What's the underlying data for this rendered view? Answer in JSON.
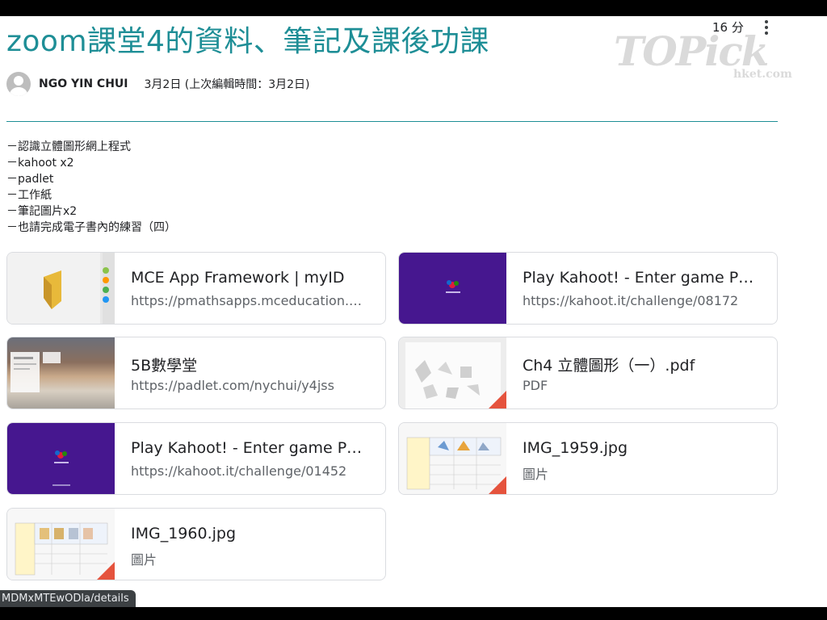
{
  "post": {
    "title": "zoom課堂4的資料、筆記及課後功課",
    "author": "NGO YIN CHUI",
    "date": "3月2日 (上次編輯時間：3月2日)",
    "comment_count": "16 分",
    "watermark": "TOPick",
    "watermark_sub": "hket.com"
  },
  "description": [
    "－認識立體圖形網上程式",
    "－kahoot x2",
    "－padlet",
    "－工作紙",
    "－筆記圖片x2",
    "－也請完成電子書內的練習（四）"
  ],
  "attachments": [
    {
      "title": "MCE App Framework | myID",
      "subtitle": "https://pmathsapps.mceducation.com",
      "thumb": "app"
    },
    {
      "title": "Play Kahoot! - Enter game PIN here!",
      "subtitle": "https://kahoot.it/challenge/08172",
      "thumb": "kahoot"
    },
    {
      "title": "5B數學堂",
      "subtitle": "https://padlet.com/nychui/y4jss",
      "thumb": "padlet"
    },
    {
      "title": "Ch4 立體圖形（一）.pdf",
      "subtitle": "PDF",
      "thumb": "pdf"
    },
    {
      "title": "Play Kahoot! - Enter game PIN here!",
      "subtitle": "https://kahoot.it/challenge/01452",
      "thumb": "kahoot"
    },
    {
      "title": "IMG_1959.jpg",
      "subtitle": "圖片",
      "thumb": "image"
    },
    {
      "title": "IMG_1960.jpg",
      "subtitle": "圖片",
      "thumb": "image"
    }
  ],
  "status_bar": "MDMxMTEwODla/details",
  "colors": {
    "accent": "#1e8e96",
    "kahoot": "#46178f",
    "file_corner": "#e5533d"
  }
}
